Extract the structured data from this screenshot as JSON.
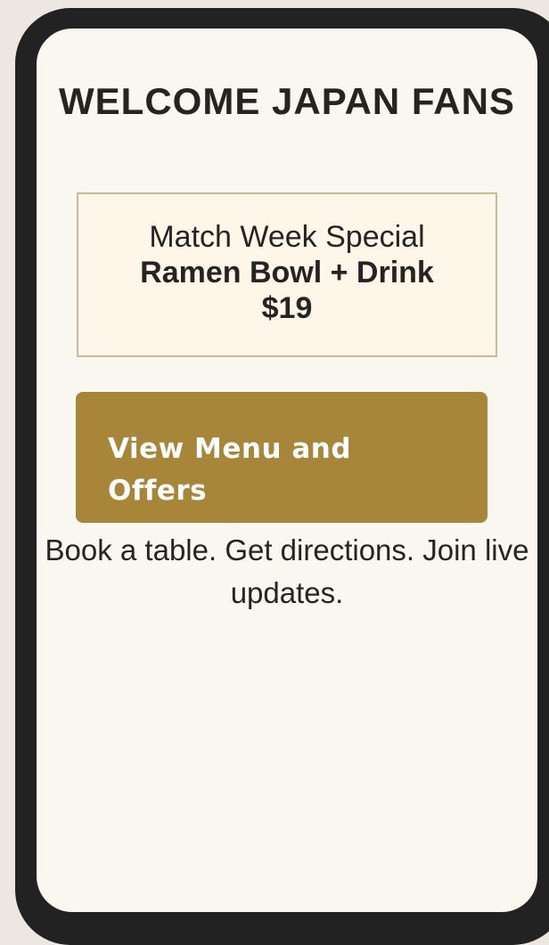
{
  "page": {
    "title": "WELCOME JAPAN FANS"
  },
  "promo": {
    "heading": "Match Week Special",
    "offer": "Ramen Bowl + Drink",
    "price": "$19"
  },
  "cta": {
    "label": "View Menu and Offers"
  },
  "footer": {
    "text": "Book a table. Get directions. Join live updates."
  },
  "colors": {
    "background": "#ece7e1",
    "frame": "#222222",
    "screen": "#faf7f1",
    "promo_background": "#fff6ea",
    "promo_border": "#cdb995",
    "accent": "#a88639",
    "text": "#262421"
  }
}
